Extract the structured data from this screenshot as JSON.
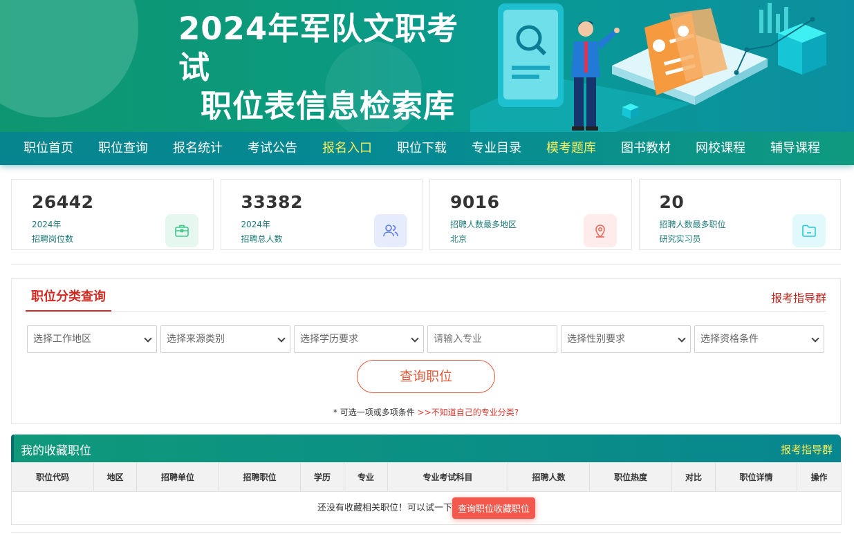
{
  "banner": {
    "title_line1": "2024年军队文职考试",
    "title_line2": "职位表信息检索库"
  },
  "nav": {
    "items": [
      {
        "label": "职位首页",
        "highlight": false
      },
      {
        "label": "职位查询",
        "highlight": false
      },
      {
        "label": "报名统计",
        "highlight": false
      },
      {
        "label": "考试公告",
        "highlight": false
      },
      {
        "label": "报名入口",
        "highlight": true
      },
      {
        "label": "职位下载",
        "highlight": false
      },
      {
        "label": "专业目录",
        "highlight": false
      },
      {
        "label": "模考题库",
        "highlight": true
      },
      {
        "label": "图书教材",
        "highlight": false
      },
      {
        "label": "网校课程",
        "highlight": false
      },
      {
        "label": "辅导课程",
        "highlight": false
      }
    ],
    "highlight_color": "#f7ef5e"
  },
  "stats": [
    {
      "value": "26442",
      "line1": "2024年",
      "line2": "招聘岗位数",
      "icon": "briefcase-icon",
      "icon_color": "#3cc98a",
      "icon_bg": "#e5f7ef"
    },
    {
      "value": "33382",
      "line1": "2024年",
      "line2": "招聘总人数",
      "icon": "users-icon",
      "icon_color": "#5a7be8",
      "icon_bg": "#e6ecfc"
    },
    {
      "value": "9016",
      "line1": "招聘人数最多地区",
      "line2": "北京",
      "icon": "location-icon",
      "icon_color": "#ee6a5a",
      "icon_bg": "#fdeceb"
    },
    {
      "value": "20",
      "line1": "招聘人数最多职位",
      "line2": "研究实习员",
      "icon": "folder-icon",
      "icon_color": "#28c6d6",
      "icon_bg": "#e2f9fb"
    }
  ],
  "search": {
    "title": "职位分类查询",
    "guide_link": "报考指导群",
    "filters": {
      "region": "选择工作地区",
      "source": "选择来源类别",
      "education": "选择学历要求",
      "major_placeholder": "请输入专业",
      "gender": "选择性别要求",
      "qualification": "选择资格条件"
    },
    "button": "查询职位",
    "hint_prefix": "* 可选一项或多项条件",
    "hint_link": ">>不知道自己的专业分类?"
  },
  "favorites": {
    "title": "我的收藏职位",
    "guide_link": "报考指导群",
    "columns": [
      "职位代码",
      "地区",
      "招聘单位",
      "招聘职位",
      "学历",
      "专业",
      "专业考试科目",
      "招聘人数",
      "职位热度",
      "对比",
      "职位详情",
      "操作"
    ],
    "empty_text": "还没有收藏相关职位！可以试一下",
    "empty_button": "查询职位收藏职位"
  }
}
